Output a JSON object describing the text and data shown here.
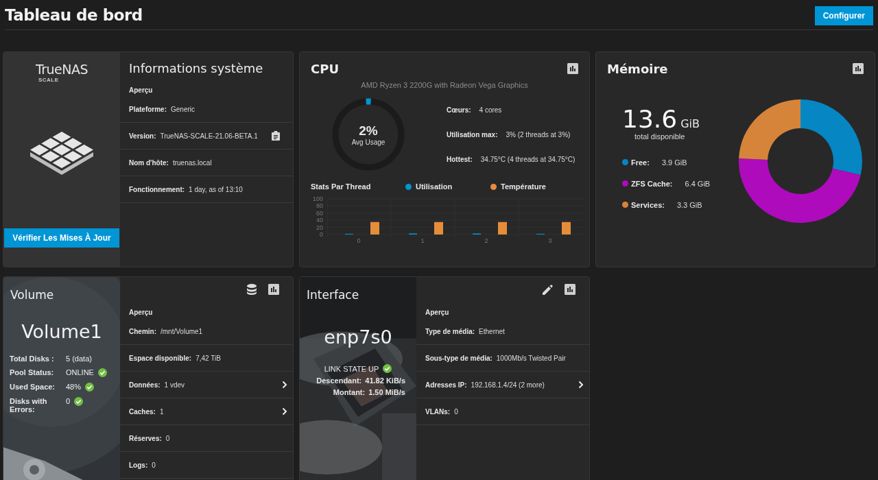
{
  "header": {
    "title": "Tableau de bord",
    "configure_button": "Configurer"
  },
  "system": {
    "logo_name": "TrueNAS",
    "logo_edition": "SCALE",
    "update_button": "Vérifier Les Mises À Jour",
    "title": "Informations système",
    "section": "Aperçu",
    "rows": [
      {
        "kind": "plain",
        "label": "Plateforme:",
        "value": "Generic"
      },
      {
        "kind": "copy",
        "label": "Version:",
        "value": "TrueNAS-SCALE-21.06-BETA.1"
      },
      {
        "kind": "plain",
        "label": "Nom d'hôte:",
        "value": "truenas.local"
      },
      {
        "kind": "plain",
        "label": "Fonctionnement:",
        "value": "1 day, as of 13:10"
      }
    ]
  },
  "cpu": {
    "title": "CPU",
    "model": "AMD Ryzen 3 2200G with Radeon Vega Graphics",
    "gauge": {
      "value": "2%",
      "caption": "Avg Usage",
      "level": 0.02
    },
    "stats": [
      {
        "label": "Cœurs:",
        "value": "4 cores"
      },
      {
        "label": "Utilisation max:",
        "value": "3%  (2 threads at 3%)"
      },
      {
        "label": "Hottest:",
        "value": "34.75°C  (4 threads at 34.75°C)"
      }
    ],
    "chart_data": {
      "type": "bar",
      "title": "Stats Par Thread",
      "legend": "top",
      "categories": [
        "0",
        "1",
        "2",
        "3"
      ],
      "ylim": [
        0,
        100
      ],
      "yticks": [
        0,
        20,
        40,
        60,
        80,
        100
      ],
      "series": [
        {
          "name": "Utilisation",
          "color": "#0095d5",
          "values": [
            2,
            3,
            3,
            2
          ]
        },
        {
          "name": "Température",
          "color": "#e68d3a",
          "values": [
            35,
            35,
            35,
            35
          ]
        }
      ]
    }
  },
  "memory": {
    "title": "Mémoire",
    "total": "13.6",
    "unit": "GiB",
    "caption": "total disponible",
    "legend": [
      {
        "label": "Free:",
        "value": "3.9 GiB",
        "color": "#0686c2"
      },
      {
        "label": "ZFS Cache:",
        "value": "6.4 GiB",
        "color": "#ae0bbc"
      },
      {
        "label": "Services:",
        "value": "3.3 GiB",
        "color": "#d6843a"
      }
    ],
    "chart_data": {
      "type": "donut",
      "series": [
        {
          "values": [
            28.6,
            47.1,
            24.3
          ],
          "colors": [
            "#0686c2",
            "#ae0bbc",
            "#d6843a"
          ]
        }
      ]
    }
  },
  "volume": {
    "title": "Volume",
    "name": "Volume1",
    "stats": [
      {
        "label": "Total Disks :",
        "value": "5 (data)",
        "ok": false
      },
      {
        "label": "Pool Status:",
        "value": "ONLINE",
        "ok": true
      },
      {
        "label": "Used Space:",
        "value": "48%",
        "ok": true
      },
      {
        "label": "Disks with Errors:",
        "value": "0",
        "ok": true
      }
    ],
    "section": "Aperçu",
    "rows": [
      {
        "kind": "plain",
        "label": "Chemin:",
        "value": "/mnt/Volume1"
      },
      {
        "kind": "plain",
        "label": "Espace disponible:",
        "value": "7,42  TiB"
      },
      {
        "kind": "link",
        "label": "Données:",
        "value": "1 vdev"
      },
      {
        "kind": "link",
        "label": "Caches:",
        "value": "1"
      },
      {
        "kind": "plain",
        "label": "Réserves:",
        "value": "0"
      },
      {
        "kind": "plain",
        "label": "Logs:",
        "value": "0"
      }
    ]
  },
  "interface": {
    "title": "Interface",
    "name": "enp7s0",
    "link_state": "LINK STATE UP",
    "link_ok": true,
    "traffic": [
      {
        "label": "Descendant:",
        "value": "41.82 KiB/s"
      },
      {
        "label": "Montant:",
        "value": "1.50 MiB/s"
      }
    ],
    "section": "Aperçu",
    "rows": [
      {
        "kind": "plain",
        "label": "Type de média:",
        "value": "Ethernet"
      },
      {
        "kind": "plain",
        "label": "Sous-type de média:",
        "value": "1000Mb/s Twisted Pair"
      },
      {
        "kind": "link",
        "label": "Adresses IP:",
        "value": "192.168.1.4/24  (2 more)"
      },
      {
        "kind": "plain",
        "label": "VLANs:",
        "value": "0"
      }
    ]
  }
}
